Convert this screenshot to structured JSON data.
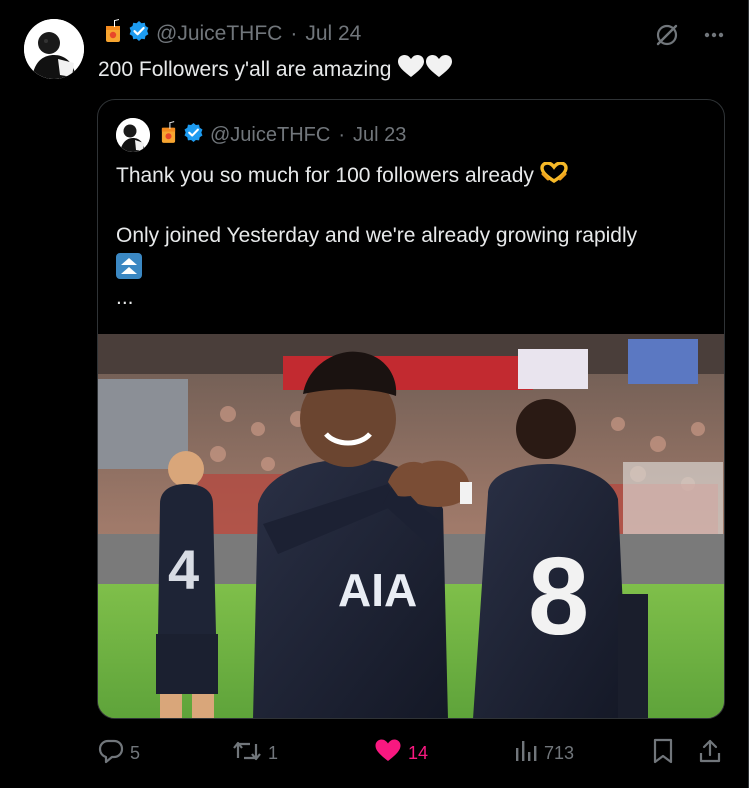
{
  "tweet": {
    "handle": "@JuiceTHFC",
    "separator": "·",
    "date": "Jul 24",
    "text": "200 Followers y'all are amazing",
    "text_emoji": "white-hearts"
  },
  "quote": {
    "handle": "@JuiceTHFC",
    "separator": "·",
    "date": "Jul 23",
    "line1": "Thank you so much for 100 followers already",
    "line1_emoji": "heart-hands",
    "line2": "Only joined Yesterday and we're already growing rapidly",
    "line3_emoji": "up-arrows",
    "line4": "..."
  },
  "actions": {
    "replies": "5",
    "reposts": "1",
    "likes": "14",
    "views": "713"
  },
  "colors": {
    "background": "#000000",
    "text": "#e7e9ea",
    "muted": "#71767b",
    "border": "#2f3336",
    "verified": "#1d9bf0",
    "like": "#f91880"
  },
  "icons": [
    "juice-box-icon",
    "verified-badge-icon",
    "grok-icon",
    "more-icon",
    "reply-icon",
    "repost-icon",
    "like-icon",
    "views-icon",
    "bookmark-icon",
    "share-icon"
  ]
}
